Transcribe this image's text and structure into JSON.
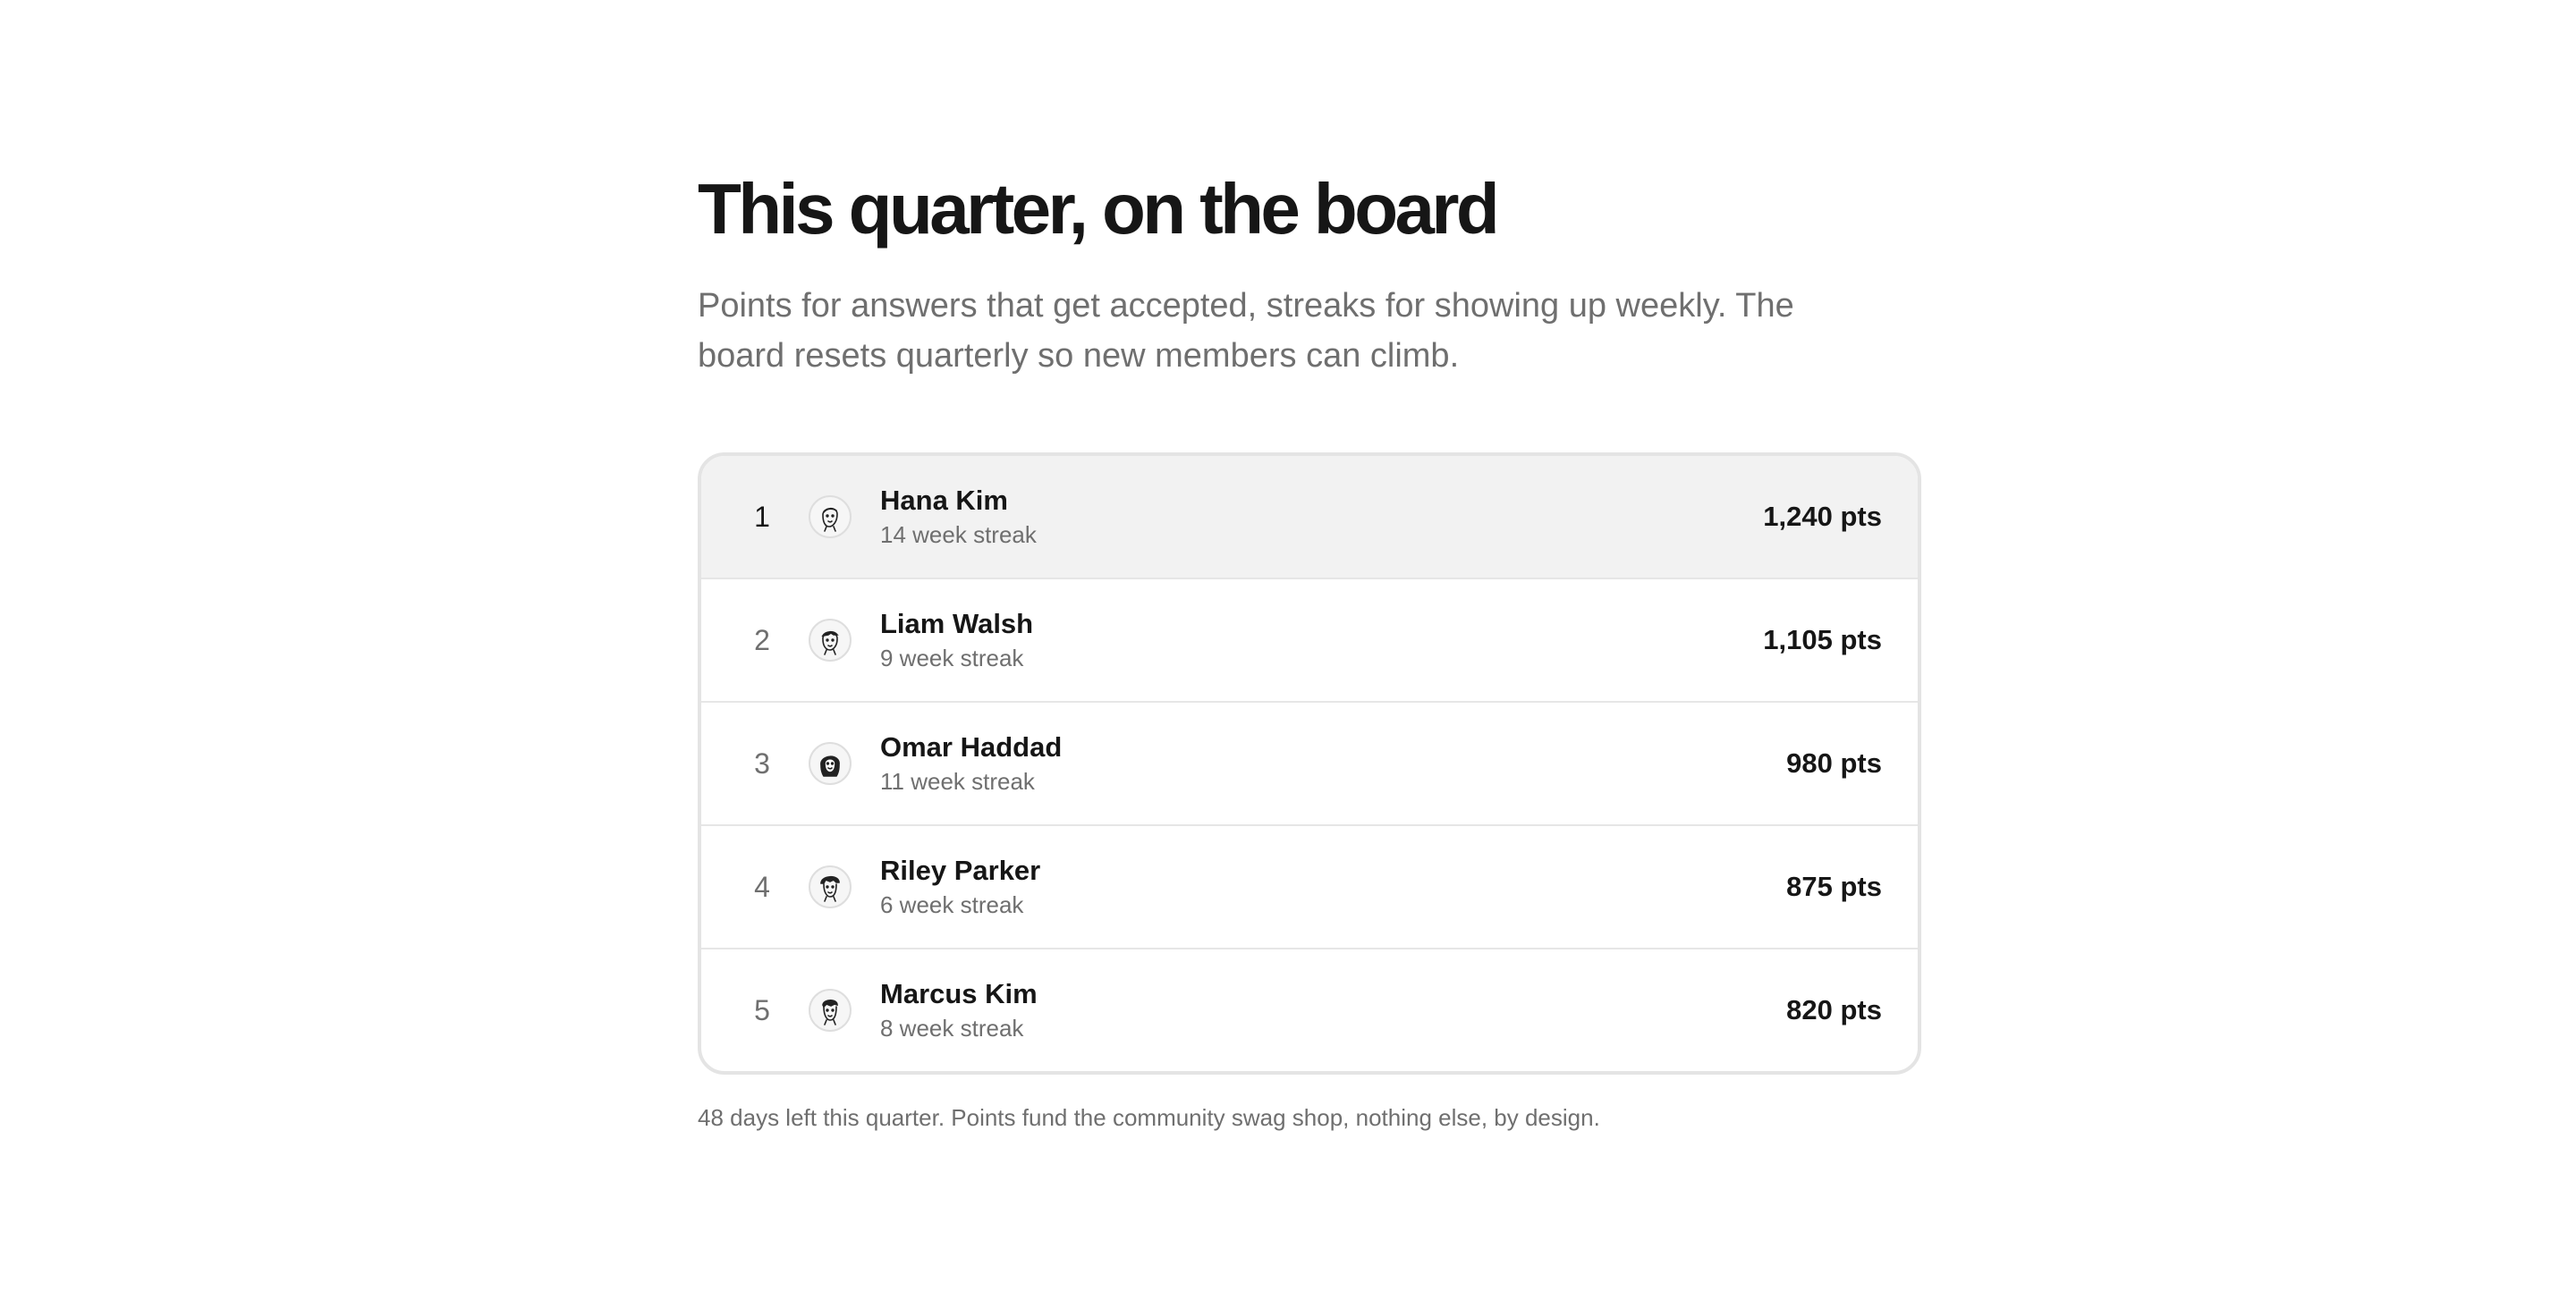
{
  "header": {
    "title": "This quarter, on the board",
    "subtitle": "Points for answers that get accepted, streaks for showing up weekly. The board resets quarterly so new members can climb."
  },
  "leaderboard": {
    "rows": [
      {
        "rank": "1",
        "name": "Hana Kim",
        "streak": "14 week streak",
        "points": "1,240 pts",
        "avatar_icon": "avatar-illustration-icon"
      },
      {
        "rank": "2",
        "name": "Liam Walsh",
        "streak": "9 week streak",
        "points": "1,105 pts",
        "avatar_icon": "avatar-illustration-icon"
      },
      {
        "rank": "3",
        "name": "Omar Haddad",
        "streak": "11 week streak",
        "points": "980 pts",
        "avatar_icon": "avatar-illustration-icon"
      },
      {
        "rank": "4",
        "name": "Riley Parker",
        "streak": "6 week streak",
        "points": "875 pts",
        "avatar_icon": "avatar-illustration-icon"
      },
      {
        "rank": "5",
        "name": "Marcus Kim",
        "streak": "8 week streak",
        "points": "820 pts",
        "avatar_icon": "avatar-illustration-icon"
      }
    ]
  },
  "footnote": "48 days left this quarter. Points fund the community swag shop, nothing else, by design.",
  "colors": {
    "text_primary": "#161616",
    "text_secondary": "#6f6f6f",
    "leader_row_bg": "#f2f2f2",
    "border": "#e4e4e4"
  }
}
